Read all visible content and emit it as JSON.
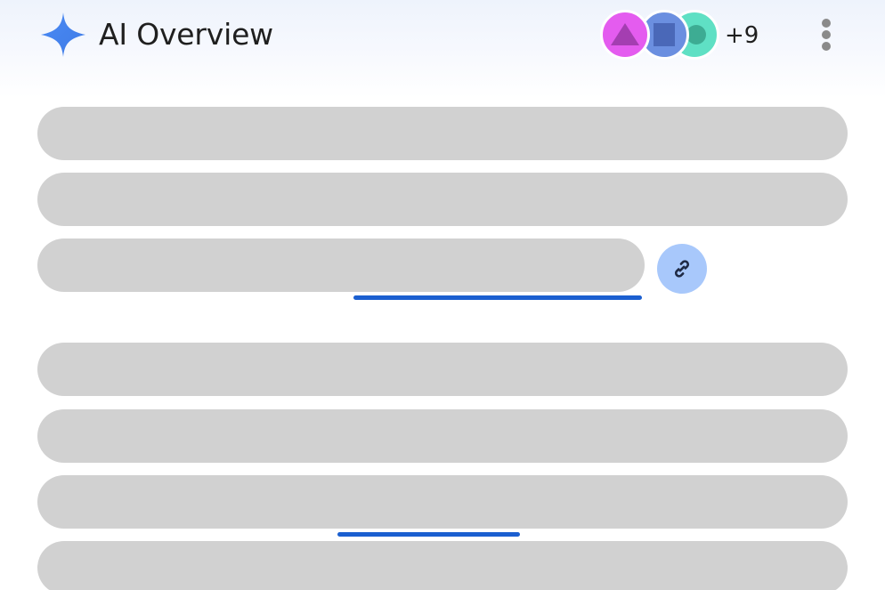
{
  "header": {
    "title": "AI Overview",
    "sparkle_icon": "sparkle-icon",
    "avatars": [
      {
        "icon": "triangle-icon",
        "color": "#e45cef"
      },
      {
        "icon": "square-icon",
        "color": "#6b8fe0"
      },
      {
        "icon": "circle-icon",
        "color": "#5fe0c4"
      }
    ],
    "more_count": "+9",
    "menu_icon": "more-vertical-icon"
  },
  "content": {
    "link_icon": "link-icon",
    "accent_color": "#1b5fd0",
    "skeleton_color": "#d1d1d1"
  }
}
